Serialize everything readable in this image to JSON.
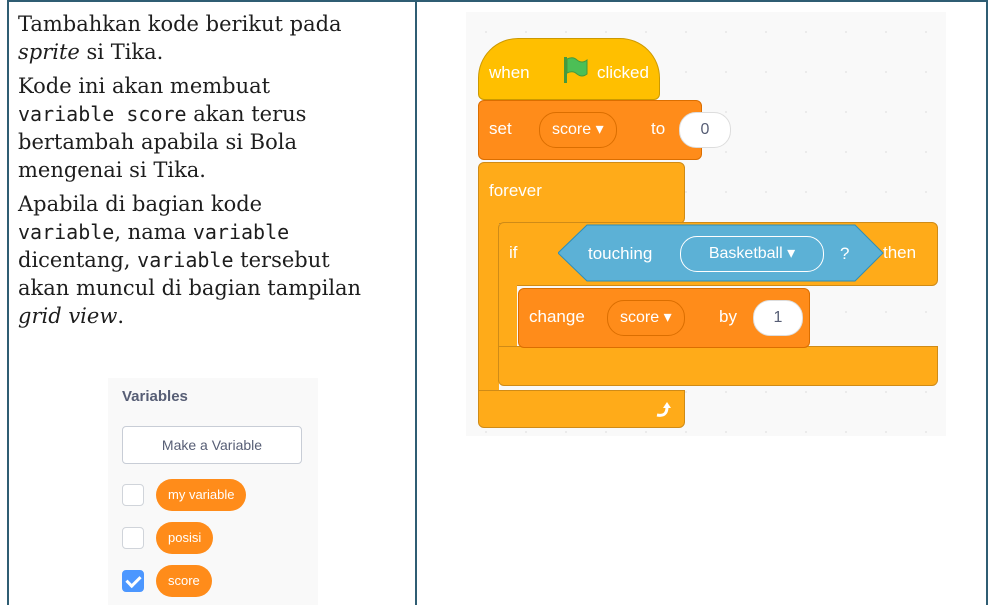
{
  "left": {
    "p1_a": "Tambahkan kode berikut pada",
    "p1_b_em": "sprite",
    "p1_b_rest": " si Tika.",
    "p2_a": "Kode ini akan membuat",
    "p2_code": "variable score",
    "p2_b": " akan terus",
    "p2_c": "bertambah apabila si Bola",
    "p2_d": "mengenai si Tika.",
    "p3_a": "Apabila di bagian kode",
    "p3_code1": "variable",
    "p3_b": ", nama ",
    "p3_code2": "variable",
    "p3_c": "dicentang, ",
    "p3_code3": "variable",
    "p3_d": " tersebut",
    "p3_e": "akan muncul di bagian tampilan",
    "p3_f_em": "grid view",
    "p3_f_rest": "."
  },
  "palette": {
    "title": "Variables",
    "make_button": "Make a Variable",
    "variables": [
      {
        "name": "my variable",
        "checked": false
      },
      {
        "name": "posisi",
        "checked": false
      },
      {
        "name": "score",
        "checked": true
      }
    ]
  },
  "code": {
    "hat": {
      "when": "when",
      "clicked": "clicked",
      "flag_icon": "green-flag-icon"
    },
    "set": {
      "label": "set",
      "var": "score ▾",
      "to": "to",
      "value": "0"
    },
    "forever": {
      "label": "forever",
      "loop_icon": "loop-arrow-icon"
    },
    "if": {
      "label": "if",
      "then": "then"
    },
    "touching": {
      "label": "touching",
      "target": "Basketball ▾",
      "q": "?"
    },
    "change": {
      "label": "change",
      "var": "score ▾",
      "by": "by",
      "value": "1"
    }
  },
  "colors": {
    "frame": "#2f5d73",
    "control": "#ffab19",
    "event": "#ffbf00",
    "variable": "#ff8c1a",
    "sensing": "#5cb1d6",
    "checkbox": "#4c97ff"
  }
}
